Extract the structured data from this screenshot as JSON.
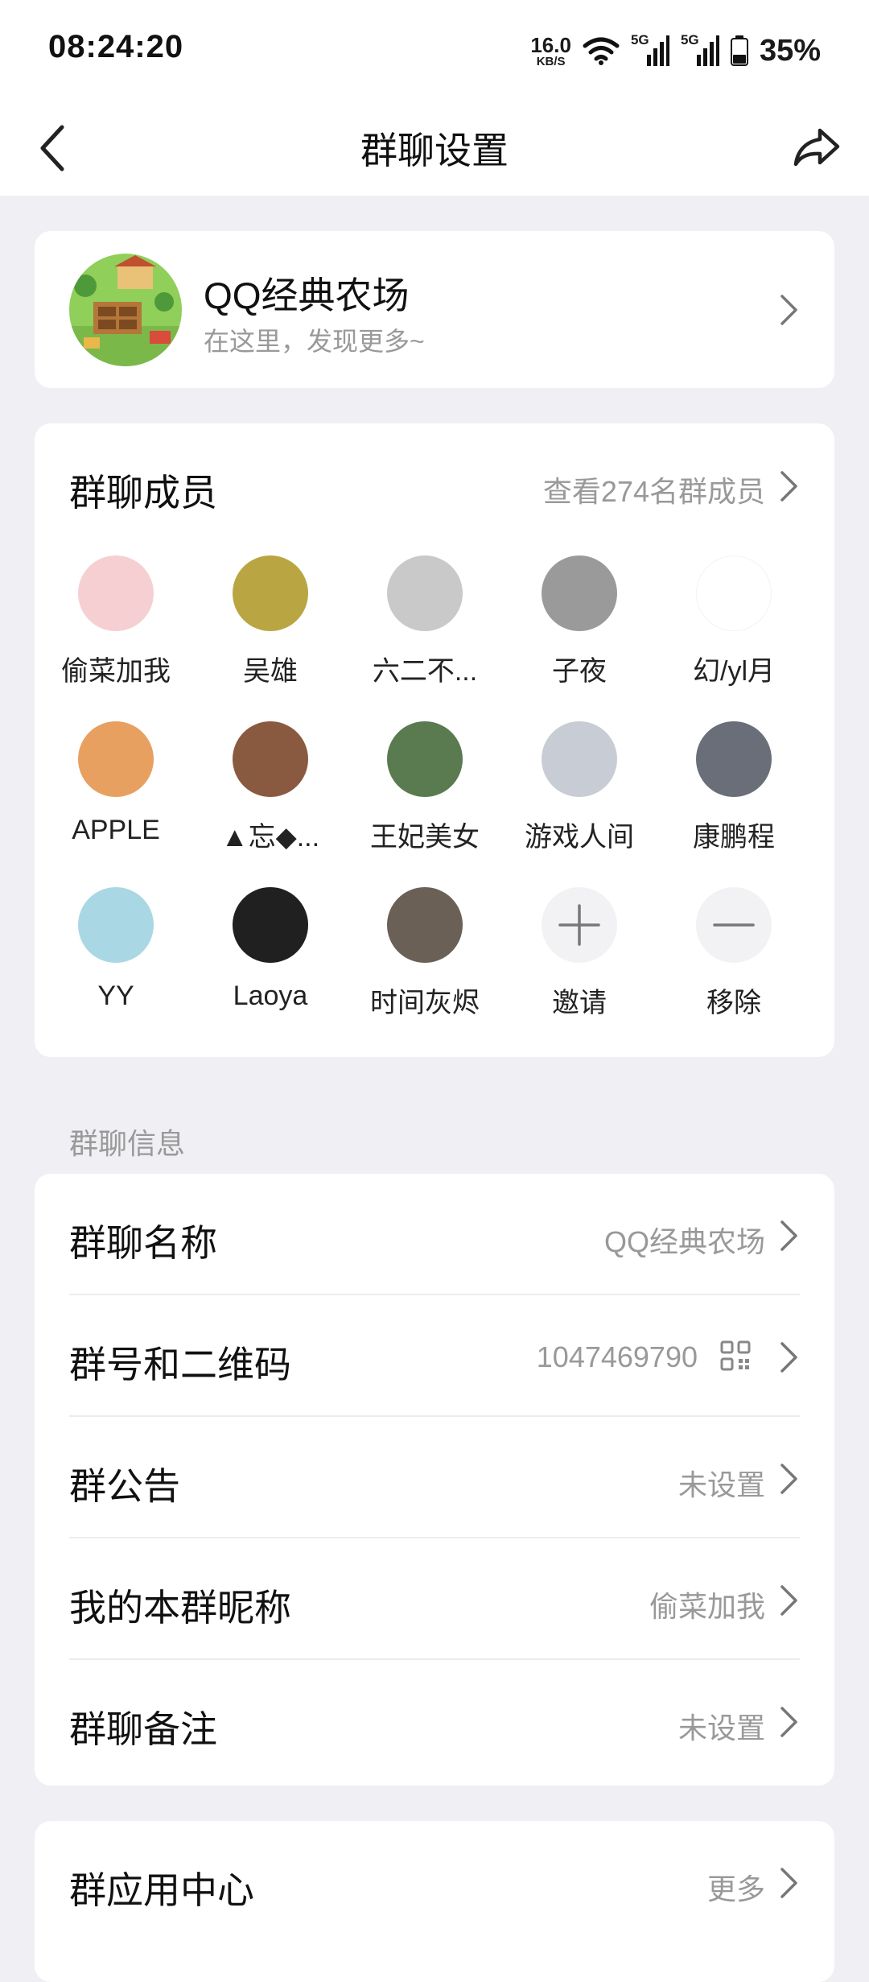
{
  "status_bar": {
    "time": "08:24:20",
    "net_speed": "16.0",
    "net_unit": "KB/S",
    "signal1": "5G",
    "signal2": "5G",
    "battery": "35%"
  },
  "nav": {
    "title": "群聊设置",
    "back_icon": "chevron-left-icon",
    "share_icon": "share-icon"
  },
  "group": {
    "name": "QQ经典农场",
    "subtitle": "在这里，发现更多~"
  },
  "members": {
    "title": "群聊成员",
    "view_all": "查看274名群成员",
    "list": [
      {
        "name": "偷菜加我",
        "color": "#f6cfd2"
      },
      {
        "name": "吴雄",
        "color": "#b9a642"
      },
      {
        "name": "六二不...",
        "color": "#c9c9c9"
      },
      {
        "name": "子夜",
        "color": "#9a9a9a"
      },
      {
        "name": "幻/yl月",
        "color": "#ffffff"
      },
      {
        "name": "APPLE",
        "color": "#e8a060"
      },
      {
        "name": "▲忘◆...",
        "color": "#8a5a40"
      },
      {
        "name": "王妃美女",
        "color": "#5a7a50"
      },
      {
        "name": "游戏人间",
        "color": "#c8ccd4"
      },
      {
        "name": "康鹏程",
        "color": "#6a6e78"
      },
      {
        "name": "YY",
        "color": "#a9d8e4"
      },
      {
        "name": "Laoya",
        "color": "#202020"
      },
      {
        "name": "时间灰烬",
        "color": "#6a6056"
      }
    ],
    "invite": "邀请",
    "remove": "移除"
  },
  "info_section_label": "群聊信息",
  "info": {
    "rows": [
      {
        "label": "群聊名称",
        "value": "QQ经典农场"
      },
      {
        "label": "群号和二维码",
        "value": "1047469790"
      },
      {
        "label": "群公告",
        "value": "未设置"
      },
      {
        "label": "我的本群昵称",
        "value": "偷菜加我"
      },
      {
        "label": "群聊备注",
        "value": "未设置"
      }
    ]
  },
  "apps": {
    "label": "群应用中心",
    "more": "更多"
  }
}
